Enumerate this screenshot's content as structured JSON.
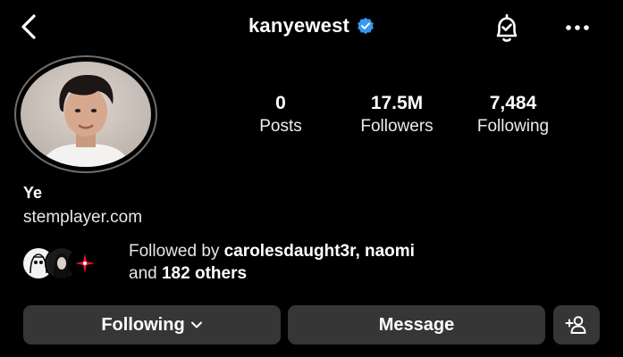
{
  "header": {
    "username": "kanyewest",
    "icons": [
      "back-arrow-icon",
      "verified-badge-icon",
      "notification-bell-icon",
      "more-options-icon"
    ]
  },
  "profile": {
    "avatar_icon": "profile-photo",
    "stats": {
      "posts_value": "0",
      "posts_label": "Posts",
      "followers_value": "17.5M",
      "followers_label": "Followers",
      "following_value": "7,484",
      "following_label": "Following"
    },
    "name": "Ye",
    "link": "stemplayer.com"
  },
  "followed_by": {
    "prefix": "Followed by ",
    "users": "carolesdaught3r, naomi",
    "and_text": "and ",
    "others": "182 others"
  },
  "actions": {
    "following_label": "Following",
    "message_label": "Message",
    "add_user_icon": "add-user-icon"
  },
  "colors": {
    "background": "#000000",
    "button": "#363636",
    "verified": "#3897f0",
    "text": "#ffffff"
  }
}
